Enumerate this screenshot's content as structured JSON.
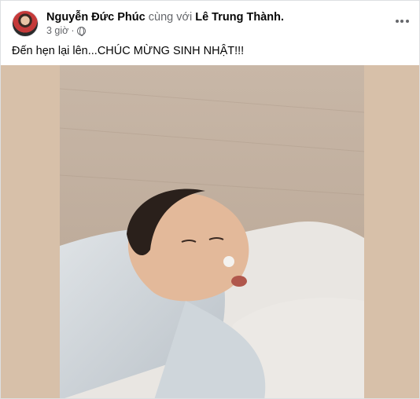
{
  "post": {
    "author": "Nguyễn Đức Phúc",
    "with_text": "cùng với",
    "tagged": "Lê Trung Thành",
    "tagged_suffix": ".",
    "time": "3 giờ",
    "separator": "·",
    "privacy_icon": "globe-icon",
    "more_icon": "more-options-icon",
    "text": "Đến hẹn lại lên...CHÚC MỪNG SINH NHẬT!!!"
  },
  "colors": {
    "text_primary": "#050505",
    "text_secondary": "#65676b",
    "media_background": "#d7c0a9"
  }
}
